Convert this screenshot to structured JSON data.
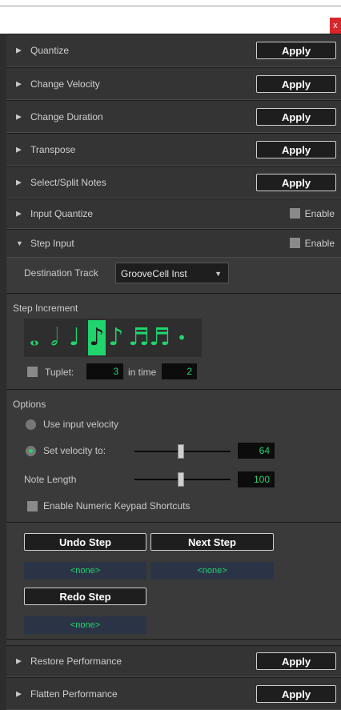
{
  "window": {
    "close_label": "x"
  },
  "sections": {
    "quantize": {
      "title": "Quantize",
      "apply": "Apply"
    },
    "change_velocity": {
      "title": "Change Velocity",
      "apply": "Apply"
    },
    "change_duration": {
      "title": "Change Duration",
      "apply": "Apply"
    },
    "transpose": {
      "title": "Transpose",
      "apply": "Apply"
    },
    "select_split": {
      "title": "Select/Split Notes",
      "apply": "Apply"
    },
    "input_quantize": {
      "title": "Input Quantize",
      "enable": "Enable"
    },
    "step_input": {
      "title": "Step Input",
      "enable": "Enable"
    },
    "restore_performance": {
      "title": "Restore Performance",
      "apply": "Apply"
    },
    "flatten_performance": {
      "title": "Flatten Performance",
      "apply": "Apply"
    }
  },
  "step_input": {
    "destination_label": "Destination Track",
    "destination_value": "GrooveCell Inst",
    "step_increment_label": "Step Increment",
    "notes": [
      "whole-note",
      "half-note",
      "quarter-note",
      "eighth-note",
      "sixteenth-note",
      "thirty-second-note",
      "sixty-fourth-note",
      "dot"
    ],
    "selected_note": "eighth-note",
    "tuplet_label": "Tuplet:",
    "tuplet_value": "3",
    "in_time_label": "in time",
    "in_time_value": "2",
    "options_label": "Options",
    "use_input_velocity": "Use input velocity",
    "set_velocity_to": "Set velocity to:",
    "velocity_value": "64",
    "note_length_label": "Note Length",
    "note_length_value": "100",
    "numeric_keypad": "Enable Numeric Keypad Shortcuts",
    "undo_step": "Undo Step",
    "next_step": "Next Step",
    "redo_step": "Redo Step",
    "undo_value": "<none>",
    "next_value": "<none>",
    "redo_value": "<none>"
  },
  "colors": {
    "accent": "#21d46e",
    "close": "#d9262b"
  }
}
